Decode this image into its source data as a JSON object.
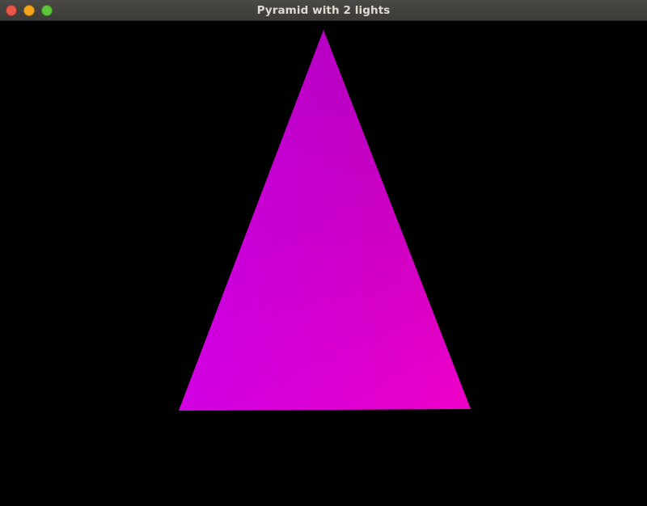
{
  "window": {
    "title": "Pyramid with 2 lights",
    "controls": {
      "close_color": "#e9574a",
      "minimize_color": "#f4a71d",
      "maximize_color": "#5ec53b"
    }
  },
  "scene": {
    "background": "#000000",
    "shape": "triangle",
    "gradient": {
      "top_color": "#aa00aa",
      "bottom_left_color": "#cc00ee",
      "bottom_right_color": "#f000c8"
    }
  }
}
